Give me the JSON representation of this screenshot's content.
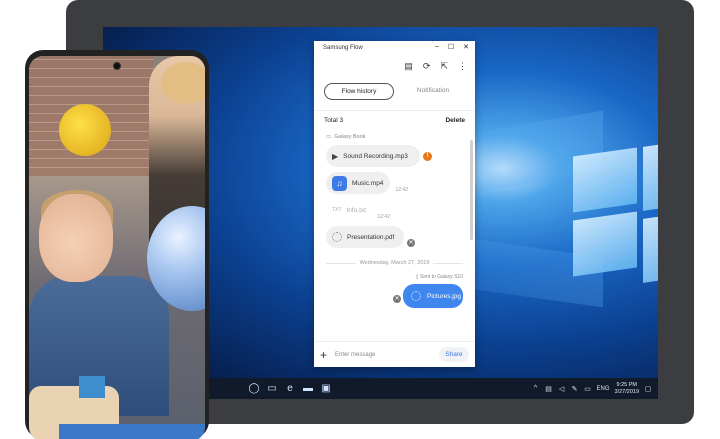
{
  "window": {
    "title": "Samsung Flow",
    "controls": {
      "minimize": "–",
      "maximize": "☐",
      "close": "✕"
    }
  },
  "toolbar": {
    "icons": [
      "clipboard-icon",
      "sync-icon",
      "open-external-icon",
      "more-icon"
    ]
  },
  "tabs": [
    {
      "label": "Flow history",
      "active": true
    },
    {
      "label": "Notification",
      "active": false
    }
  ],
  "summary": {
    "total": "Total 3",
    "delete_label": "Delete"
  },
  "history": {
    "device_label": "Galaxy Book",
    "items": [
      {
        "name": "Sound Recording.mp3",
        "icon": "play-icon",
        "status": "!"
      },
      {
        "name": "Music.mp4",
        "icon": "music-file-icon",
        "time": "12:42"
      },
      {
        "name": "Info.txt",
        "icon": "text-file-icon",
        "prefix": "TXT",
        "time": "12:42"
      },
      {
        "name": "Presentation.pdf",
        "icon": "loading-icon",
        "status": "✕"
      }
    ],
    "date_separator": "Wednesday, March 27, 2019",
    "sent_label": "Sent to Galaxy S10",
    "outgoing": {
      "name": "Pictures.jpg",
      "status": "✕"
    }
  },
  "input": {
    "placeholder": "Enter message",
    "share_label": "Share"
  },
  "taskbar": {
    "language": "ENG",
    "time": "9:25 PM",
    "date": "3/27/2019"
  },
  "colors": {
    "accent": "#3f86ee",
    "warning": "#e8771a",
    "taskbar": "#101a2a"
  }
}
